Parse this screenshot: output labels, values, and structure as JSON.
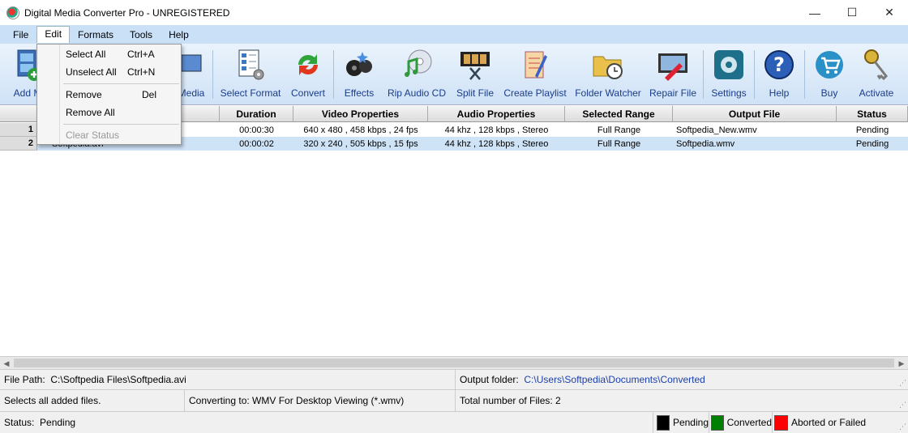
{
  "window": {
    "title": "Digital Media Converter Pro - UNREGISTERED",
    "minimize": "—",
    "maximize": "☐",
    "close": "✕"
  },
  "menu": [
    "File",
    "Edit",
    "Formats",
    "Tools",
    "Help"
  ],
  "toolbar": [
    {
      "label": "Add M",
      "icon": "add-media-icon"
    },
    {
      "label": "Media",
      "icon": "media-icon"
    },
    {
      "label": "Select Format",
      "icon": "select-format-icon"
    },
    {
      "label": "Convert",
      "icon": "convert-icon"
    },
    {
      "label": "Effects",
      "icon": "effects-icon"
    },
    {
      "label": "Rip Audio CD",
      "icon": "rip-audio-cd-icon"
    },
    {
      "label": "Split File",
      "icon": "split-file-icon"
    },
    {
      "label": "Create Playlist",
      "icon": "create-playlist-icon"
    },
    {
      "label": "Folder Watcher",
      "icon": "folder-watcher-icon"
    },
    {
      "label": "Repair File",
      "icon": "repair-file-icon"
    },
    {
      "label": "Settings",
      "icon": "settings-icon"
    },
    {
      "label": "Help",
      "icon": "help-icon"
    },
    {
      "label": "Buy",
      "icon": "buy-icon"
    },
    {
      "label": "Activate",
      "icon": "activate-icon"
    }
  ],
  "edit_menu": {
    "select_all": {
      "label": "Select All",
      "shortcut": "Ctrl+A"
    },
    "unselect_all": {
      "label": "Unselect All",
      "shortcut": "Ctrl+N"
    },
    "remove": {
      "label": "Remove",
      "shortcut": "Del"
    },
    "remove_all": {
      "label": "Remove All"
    },
    "clear_status": {
      "label": "Clear Status"
    }
  },
  "table": {
    "columns": [
      "Duration",
      "Video Properties",
      "Audio Properties",
      "Selected Range",
      "Output File",
      "Status"
    ],
    "rows": [
      {
        "num": "1",
        "name": "",
        "duration": "00:00:30",
        "video": "640 x 480 , 458 kbps , 24 fps",
        "audio": "44 khz , 128 kbps , Stereo",
        "range": "Full Range",
        "output": "Softpedia_New.wmv",
        "status": "Pending"
      },
      {
        "num": "2",
        "name": "Softpedia.avi",
        "duration": "00:00:02",
        "video": "320 x 240 , 505 kbps , 15 fps",
        "audio": "44 khz , 128 kbps , Stereo",
        "range": "Full Range",
        "output": "Softpedia.wmv",
        "status": "Pending"
      }
    ]
  },
  "status": {
    "file_path_label": "File Path:",
    "file_path": "C:\\Softpedia Files\\Softpedia.avi",
    "output_folder_label": "Output folder:",
    "output_folder": "C:\\Users\\Softpedia\\Documents\\Converted",
    "hint": "Selects all added files.",
    "converting_to": "Converting to: WMV For Desktop Viewing (*.wmv)",
    "total_files": "Total number of Files: 2",
    "status_label": "Status:",
    "status_value": "Pending",
    "legend": [
      {
        "label": "Pending",
        "color": "#000000"
      },
      {
        "label": "Converted",
        "color": "#008000"
      },
      {
        "label": "Aborted or Failed",
        "color": "#ff0000"
      }
    ]
  }
}
